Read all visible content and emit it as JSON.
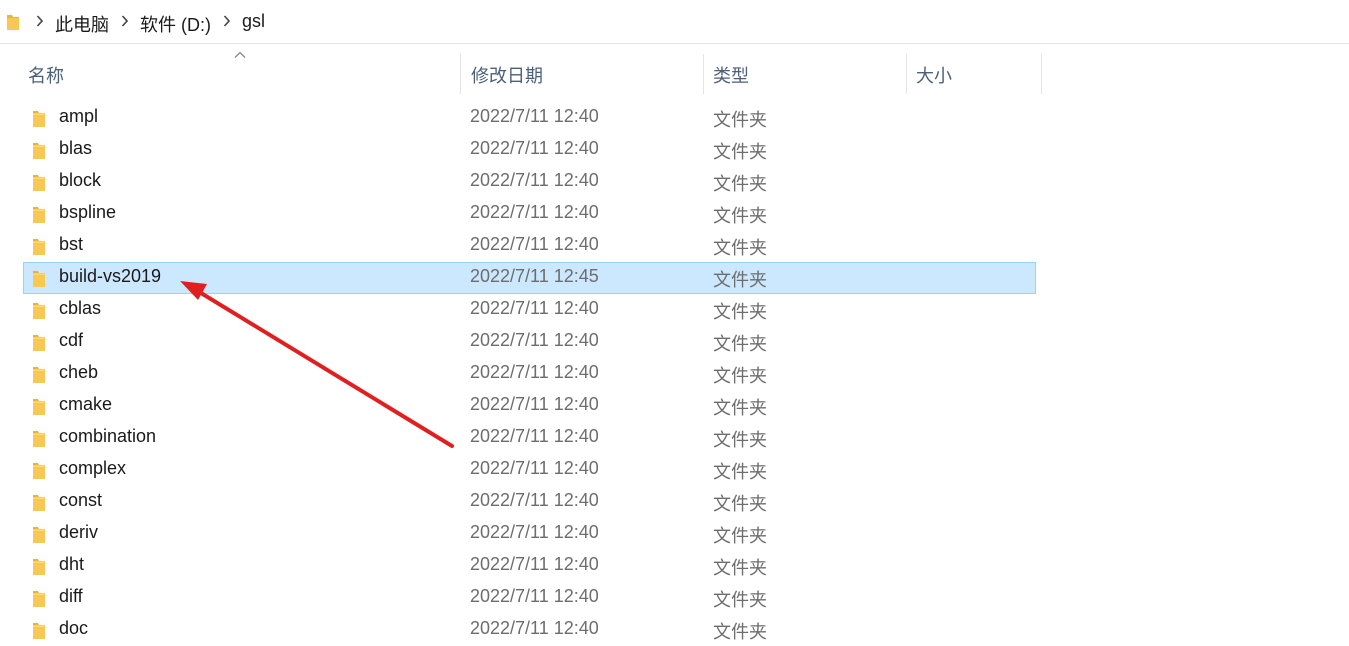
{
  "breadcrumb": {
    "items": [
      "此电脑",
      "软件 (D:)",
      "gsl"
    ]
  },
  "columns": {
    "name": "名称",
    "date": "修改日期",
    "type": "类型",
    "size": "大小"
  },
  "files": [
    {
      "name": "ampl",
      "date": "2022/7/11 12:40",
      "type": "文件夹"
    },
    {
      "name": "blas",
      "date": "2022/7/11 12:40",
      "type": "文件夹"
    },
    {
      "name": "block",
      "date": "2022/7/11 12:40",
      "type": "文件夹"
    },
    {
      "name": "bspline",
      "date": "2022/7/11 12:40",
      "type": "文件夹"
    },
    {
      "name": "bst",
      "date": "2022/7/11 12:40",
      "type": "文件夹"
    },
    {
      "name": "build-vs2019",
      "date": "2022/7/11 12:45",
      "type": "文件夹",
      "selected": true
    },
    {
      "name": "cblas",
      "date": "2022/7/11 12:40",
      "type": "文件夹"
    },
    {
      "name": "cdf",
      "date": "2022/7/11 12:40",
      "type": "文件夹"
    },
    {
      "name": "cheb",
      "date": "2022/7/11 12:40",
      "type": "文件夹"
    },
    {
      "name": "cmake",
      "date": "2022/7/11 12:40",
      "type": "文件夹"
    },
    {
      "name": "combination",
      "date": "2022/7/11 12:40",
      "type": "文件夹"
    },
    {
      "name": "complex",
      "date": "2022/7/11 12:40",
      "type": "文件夹"
    },
    {
      "name": "const",
      "date": "2022/7/11 12:40",
      "type": "文件夹"
    },
    {
      "name": "deriv",
      "date": "2022/7/11 12:40",
      "type": "文件夹"
    },
    {
      "name": "dht",
      "date": "2022/7/11 12:40",
      "type": "文件夹"
    },
    {
      "name": "diff",
      "date": "2022/7/11 12:40",
      "type": "文件夹"
    },
    {
      "name": "doc",
      "date": "2022/7/11 12:40",
      "type": "文件夹"
    }
  ],
  "colors": {
    "selection_bg": "#cce8ff",
    "selection_border": "#99d1ff",
    "annotation_arrow": "#e02020",
    "folder_icon": "#f8c855"
  }
}
